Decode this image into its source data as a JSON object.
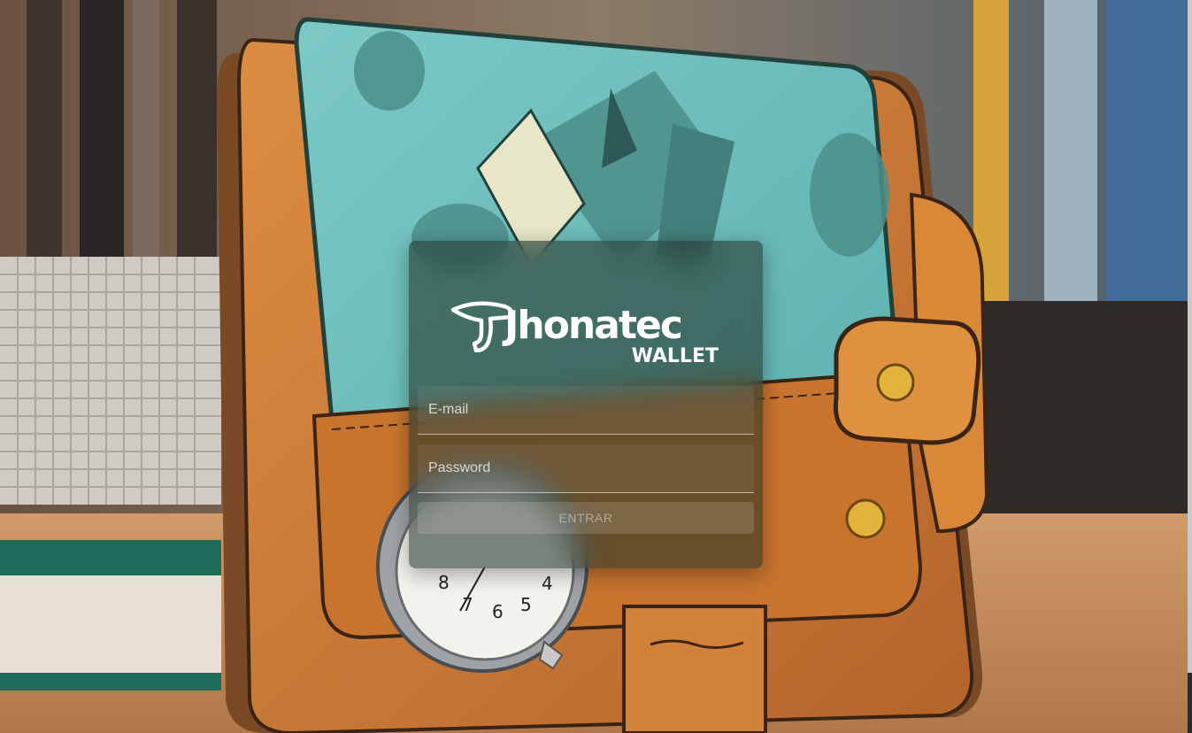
{
  "brand": {
    "name": "Jhonatec",
    "product": "WALLET",
    "logo_icon": "bird-head-logo-icon"
  },
  "login": {
    "email_placeholder": "E-mail",
    "password_placeholder": "Password",
    "submit_label": "ENTRAR"
  },
  "background": {
    "image_icon": "wallet-illustration",
    "colors": {
      "wallet_leather": "#c97a34",
      "wallet_teal": "#6fbfbd",
      "desk": "#c28a5c"
    }
  },
  "colors": {
    "card_overlay": "#223428",
    "text": "#ffffff",
    "button_text_disabled": "#8a928c"
  }
}
